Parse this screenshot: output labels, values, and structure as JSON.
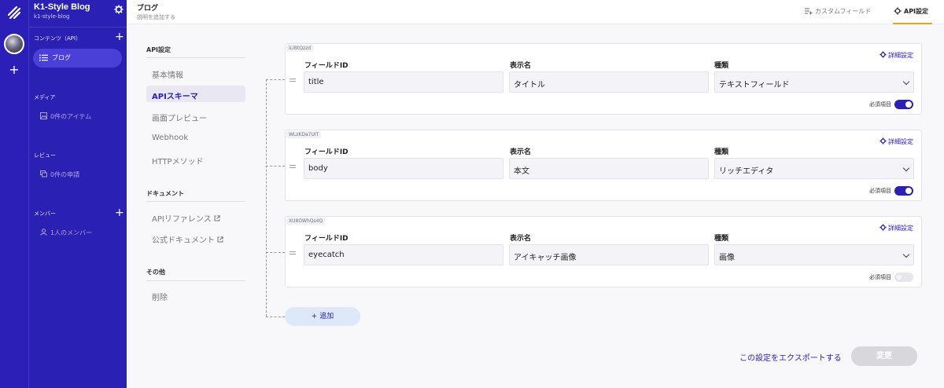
{
  "app": {
    "name": "K1-Style Blog",
    "subdomain": "k1-style-blog"
  },
  "sidebar": {
    "sections": {
      "contents": "コンテンツ（API）",
      "media": "メディア",
      "review": "レビュー",
      "members": "メンバー"
    },
    "items": {
      "blog": "ブログ",
      "media_count": "0件のアイテム",
      "review_count": "0件の申請",
      "member_count": "1人のメンバー"
    }
  },
  "header": {
    "title": "ブログ",
    "subtitle": "説明を追加する",
    "tabs": {
      "custom_field": "カスタムフィールド",
      "api_settings": "API設定"
    }
  },
  "submenu": {
    "api_section": "API設定",
    "api_items": [
      "基本情報",
      "APIスキーマ",
      "画面プレビュー",
      "Webhook",
      "HTTPメソッド"
    ],
    "doc_section": "ドキュメント",
    "doc_items": [
      "APIリファレンス",
      "公式ドキュメント"
    ],
    "other_section": "その他",
    "other_items": [
      "削除"
    ]
  },
  "fields": {
    "labels": {
      "field_id": "フィールドID",
      "display_name": "表示名",
      "type": "種類",
      "advanced": "詳細設定",
      "required": "必須項目"
    },
    "rows": [
      {
        "tag": "iLIBtQzzd",
        "id": "title",
        "name": "タイトル",
        "type": "テキストフィールド",
        "required": true
      },
      {
        "tag": "WLzKDa7UIT",
        "id": "body",
        "name": "本文",
        "type": "リッチエディタ",
        "required": true
      },
      {
        "tag": "XU8OWhQs4Q",
        "id": "eyecatch",
        "name": "アイキャッチ画像",
        "type": "画像",
        "required": false
      }
    ]
  },
  "actions": {
    "add": "+ 追加",
    "export": "この設定をエクスポートする",
    "change": "変更"
  }
}
